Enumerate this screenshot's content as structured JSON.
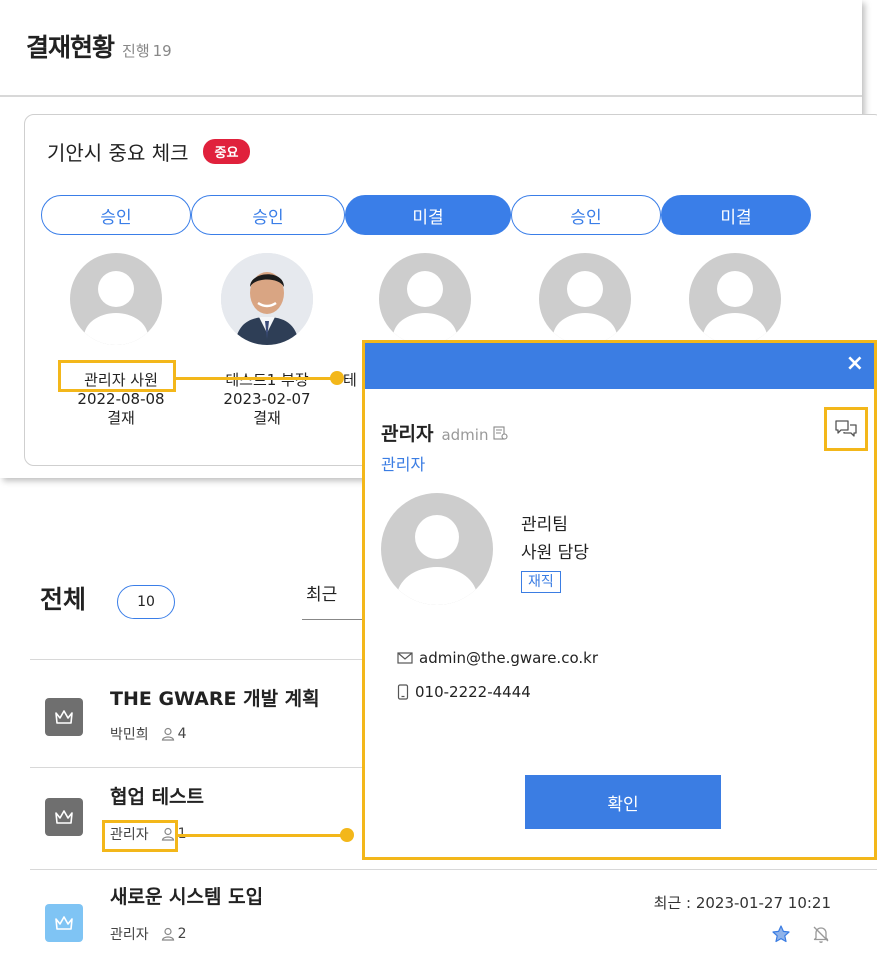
{
  "approval": {
    "title": "결재현황",
    "progress_label": "진행",
    "progress_count": "19",
    "doc_title": "기안시 중요 체크",
    "doc_badge": "중요",
    "steps": [
      {
        "label": "승인",
        "state": "approved"
      },
      {
        "label": "승인",
        "state": "approved"
      },
      {
        "label": "미결",
        "state": "pending"
      },
      {
        "label": "승인",
        "state": "approved"
      },
      {
        "label": "미결",
        "state": "pending"
      }
    ],
    "approvers": [
      {
        "name": "관리자 사원",
        "date": "2022-08-08",
        "state": "결재"
      },
      {
        "name": "테스트1 부장",
        "date": "2023-02-07",
        "state": "결재"
      },
      {
        "name": "테"
      }
    ]
  },
  "list": {
    "title": "전체",
    "count": "10",
    "sort_label": "최근",
    "items": [
      {
        "title": "THE GWARE 개발 계획",
        "owner": "박민희",
        "members": "4",
        "icon": "crown-icon",
        "icon_color": "#6f6f6f"
      },
      {
        "title": "협업 테스트",
        "owner": "관리자",
        "members": "1",
        "icon": "crown-icon",
        "icon_color": "#6f6f6f"
      },
      {
        "title": "새로운 시스템 도입",
        "owner": "관리자",
        "members": "2",
        "icon": "crown-icon",
        "icon_color": "#7fc4f4",
        "recent": "최근 : 2023-01-27 10:21"
      }
    ]
  },
  "profile_popup": {
    "close": "×",
    "name": "관리자",
    "user_id": "admin",
    "dept_link": "관리자",
    "team": "관리팀",
    "position": "사원 담당",
    "status": "재직",
    "email": "admin@the.gware.co.kr",
    "phone": "010-2222-4444",
    "confirm": "확인"
  },
  "colors": {
    "accent": "#3b7de3",
    "highlight": "#f3b71a",
    "badge_red": "#e0213c"
  }
}
